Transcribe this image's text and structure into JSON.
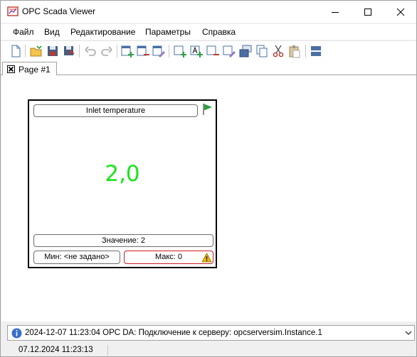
{
  "window": {
    "title": "OPC Scada Viewer"
  },
  "menu": {
    "items": [
      "Файл",
      "Вид",
      "Редактирование",
      "Параметры",
      "Справка"
    ]
  },
  "toolbar": {
    "buttons": [
      "new-icon",
      "open-icon",
      "save-icon",
      "save-all-icon",
      "undo-icon",
      "redo-icon",
      "add-page-icon",
      "remove-page-icon",
      "edit-page-icon",
      "add-widget-icon",
      "add-text-icon",
      "remove-widget-icon",
      "edit-widget-icon",
      "bring-to-front-icon",
      "copy-icon",
      "cut-icon",
      "paste-icon",
      "align-icon"
    ]
  },
  "tabs": [
    {
      "label": "Page #1"
    }
  ],
  "widget": {
    "title": "Inlet temperature",
    "value": "2,0",
    "status": "Значение: 2",
    "min": "Мин: <не задано>",
    "max": "Макс: 0",
    "value_color": "#19e619",
    "flag_color": "#2e9e3e",
    "alarm_border_color": "#c81e1e"
  },
  "log": {
    "message": "2024-12-07 11:23:04 OPC DA: Подключение к серверу: opcserversim.Instance.1"
  },
  "status": {
    "datetime": "07.12.2024 11:23:13"
  }
}
